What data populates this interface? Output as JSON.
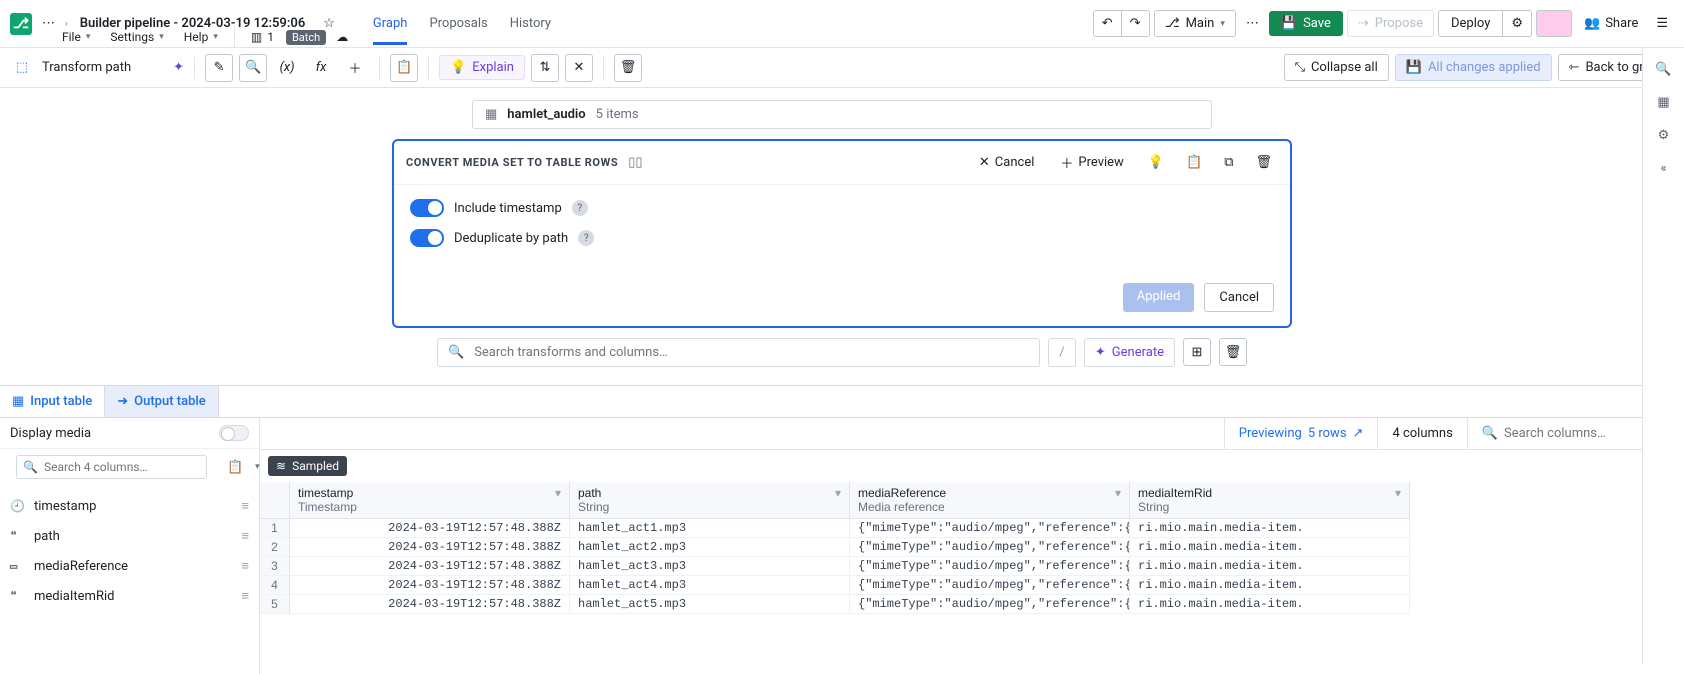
{
  "header": {
    "title": "Builder pipeline - 2024-03-19 12:59:06",
    "menus": {
      "file": "File",
      "settings": "Settings",
      "help": "Help"
    },
    "panes_count": "1",
    "batch_label": "Batch",
    "tabs": {
      "graph": "Graph",
      "proposals": "Proposals",
      "history": "History"
    },
    "branch": "Main",
    "save": "Save",
    "propose": "Propose",
    "deploy": "Deploy",
    "share": "Share"
  },
  "toolbar": {
    "transform_path": "Transform path",
    "explain": "Explain",
    "collapse_all": "Collapse all",
    "all_changes_applied": "All changes applied",
    "back_to_graph": "Back to graph"
  },
  "dataset": {
    "name": "hamlet_audio",
    "count": "5 items"
  },
  "transform_card": {
    "title": "CONVERT MEDIA SET TO TABLE ROWS",
    "cancel": "Cancel",
    "preview": "Preview",
    "opt1": "Include timestamp",
    "opt2": "Deduplicate by path",
    "applied_btn": "Applied",
    "cancel_btn": "Cancel"
  },
  "search": {
    "placeholder": "Search transforms and columns…",
    "slash": "/",
    "generate": "Generate"
  },
  "io_tabs": {
    "input": "Input table",
    "output": "Output table"
  },
  "left": {
    "display_media": "Display media",
    "search_cols_ph": "Search 4 columns…",
    "cols": [
      "timestamp",
      "path",
      "mediaReference",
      "mediaItemRid"
    ]
  },
  "status": {
    "previewing": "Previewing",
    "rows": "5 rows",
    "cols": "4 columns",
    "search_ph": "Search columns…",
    "sampled": "Sampled"
  },
  "table": {
    "headers": [
      {
        "name": "timestamp",
        "type": "Timestamp"
      },
      {
        "name": "path",
        "type": "String"
      },
      {
        "name": "mediaReference",
        "type": "Media reference"
      },
      {
        "name": "mediaItemRid",
        "type": "String"
      }
    ],
    "rows": [
      {
        "n": "1",
        "ts": "2024-03-19T12:57:48.388Z",
        "path": "hamlet_act1.mp3",
        "mr": "{\"mimeType\":\"audio/mpeg\",\"reference\":{\"ty",
        "rid": "ri.mio.main.media-item."
      },
      {
        "n": "2",
        "ts": "2024-03-19T12:57:48.388Z",
        "path": "hamlet_act2.mp3",
        "mr": "{\"mimeType\":\"audio/mpeg\",\"reference\":{\"ty",
        "rid": "ri.mio.main.media-item."
      },
      {
        "n": "3",
        "ts": "2024-03-19T12:57:48.388Z",
        "path": "hamlet_act3.mp3",
        "mr": "{\"mimeType\":\"audio/mpeg\",\"reference\":{\"ty",
        "rid": "ri.mio.main.media-item."
      },
      {
        "n": "4",
        "ts": "2024-03-19T12:57:48.388Z",
        "path": "hamlet_act4.mp3",
        "mr": "{\"mimeType\":\"audio/mpeg\",\"reference\":{\"ty",
        "rid": "ri.mio.main.media-item."
      },
      {
        "n": "5",
        "ts": "2024-03-19T12:57:48.388Z",
        "path": "hamlet_act5.mp3",
        "mr": "{\"mimeType\":\"audio/mpeg\",\"reference\":{\"ty",
        "rid": "ri.mio.main.media-item."
      }
    ]
  }
}
